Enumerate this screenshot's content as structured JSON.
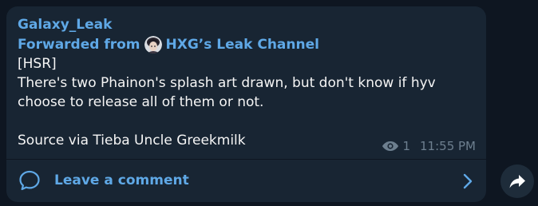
{
  "post": {
    "channel_name": "Galaxy_Leak",
    "forwarded_prefix": "Forwarded from",
    "forwarded_source": "HXG’s Leak Channel",
    "body_lines": [
      "[HSR]",
      "There's two Phainon's splash art drawn, but don't know if hyv",
      "choose to release all of them or not.",
      "",
      "Source via Tieba Uncle Greekmilk"
    ],
    "views": "1",
    "time": "11:55 PM"
  },
  "comments": {
    "label": "Leave a comment"
  },
  "icons": {
    "views": "eye-icon",
    "comment": "comment-bubble-icon",
    "open": "chevron-right-icon",
    "share": "share-arrow-icon",
    "avatar": "channel-avatar"
  },
  "colors": {
    "background": "#0e1621",
    "bubble": "#182533",
    "accent": "#5fa8e6",
    "text": "#f5f5f5",
    "meta": "#6d7f8f",
    "share_button": "#1e2c3a"
  }
}
